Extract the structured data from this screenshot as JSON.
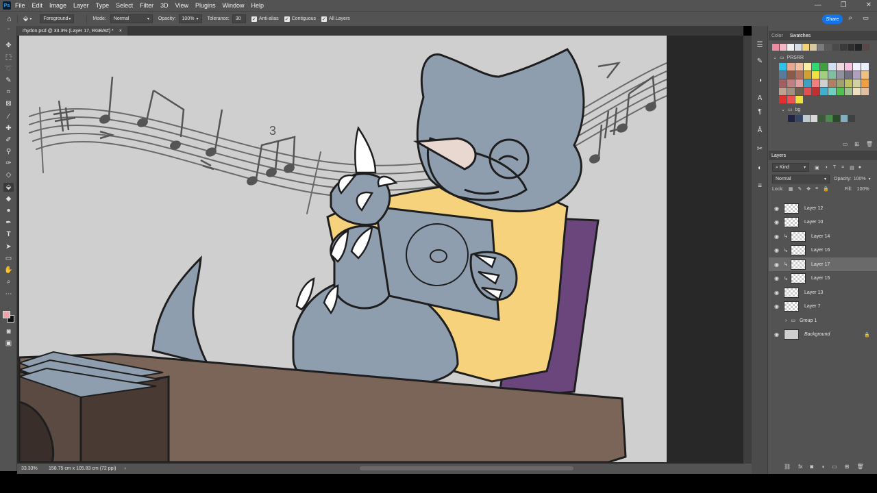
{
  "menu": {
    "logo": "Ps",
    "items": [
      "File",
      "Edit",
      "Image",
      "Layer",
      "Type",
      "Select",
      "Filter",
      "3D",
      "View",
      "Plugins",
      "Window",
      "Help"
    ]
  },
  "options": {
    "fill_source": "Foreground",
    "mode_label": "Mode:",
    "mode_value": "Normal",
    "opacity_label": "Opacity:",
    "opacity_value": "100%",
    "tolerance_label": "Tolerance:",
    "tolerance_value": "30",
    "antialias": "Anti-alias",
    "contiguous": "Contiguous",
    "all_layers": "All Layers",
    "share": "Share"
  },
  "document": {
    "tab_title": "rhydon.psd @ 33.3% (Layer 17, RGB/8#) *",
    "zoom": "33.33%",
    "dimensions": "158.75 cm x 105.83 cm (72 ppi)"
  },
  "swatches_panel": {
    "tabs": [
      "Color",
      "Swatches"
    ],
    "top_colors": [
      "#f08aa0",
      "#f4b8c4",
      "#f0f0f0",
      "#d6dde8",
      "#f2d27a",
      "#d8c8a0",
      "#7a7a7a",
      "#5a5a5a",
      "#4a4a4a",
      "#3a3a3a",
      "#2e2e2e",
      "#222222",
      "#584848"
    ],
    "folder_name": "PRSRR",
    "grid": [
      [
        "#30c0e8",
        "#e8a890",
        "#f0c0a0",
        "#f8f0a0",
        "#30d870",
        "#40a040",
        "#d0e0f0",
        "#f0d8e0",
        "#f8c0e0",
        "#f0f0ff",
        "#e8f0ff"
      ],
      [
        "#5a7a9a",
        "#8a5a4a",
        "#b07060",
        "#d0a030",
        "#f0e040",
        "#a0d080",
        "#80c0a0",
        "#9090a0",
        "#707080",
        "#b0a0c0",
        "#f0c080"
      ],
      [
        "#a06060",
        "#c08080",
        "#e0a0a0",
        "#40a0c0",
        "#f08080",
        "#d0d0d0",
        "#b08060",
        "#a0a070",
        "#c0c060",
        "#d0d0a0",
        "#f0a040"
      ],
      [
        "#c0a090",
        "#a09080",
        "#706050",
        "#e05050",
        "#c03030",
        "#40b0d0",
        "#70d0c0",
        "#50c050",
        "#a0c090",
        "#f0e0c0",
        "#e0c0a0"
      ],
      [
        "#e03030",
        "#f05050",
        "#f0e040"
      ]
    ],
    "subfolder_name": "bg",
    "bg_colors": [
      "#222244",
      "#334466",
      "#c0c8d0",
      "#d8d8d8",
      "#3a5a3a",
      "#4a8a4a",
      "#2a4a2a",
      "#80b0c0",
      "#404040"
    ]
  },
  "layers_panel": {
    "title": "Layers",
    "filter_kind": "Kind",
    "blend_mode": "Normal",
    "opacity_label": "Opacity:",
    "opacity_value": "100%",
    "lock_label": "Lock:",
    "fill_label": "Fill:",
    "fill_value": "100%",
    "layers": [
      {
        "name": "Layer 12",
        "clipped": false,
        "selected": false,
        "visible": true
      },
      {
        "name": "Layer 10",
        "clipped": false,
        "selected": false,
        "visible": true
      },
      {
        "name": "Layer 14",
        "clipped": true,
        "selected": false,
        "visible": true
      },
      {
        "name": "Layer 16",
        "clipped": true,
        "selected": false,
        "visible": true
      },
      {
        "name": "Layer 17",
        "clipped": true,
        "selected": true,
        "visible": true
      },
      {
        "name": "Layer 15",
        "clipped": true,
        "selected": false,
        "visible": true
      },
      {
        "name": "Layer 13",
        "clipped": false,
        "selected": false,
        "visible": true
      },
      {
        "name": "Layer 7",
        "clipped": false,
        "selected": false,
        "visible": true
      },
      {
        "name": "Group 1",
        "clipped": false,
        "selected": false,
        "visible": false
      },
      {
        "name": "Background",
        "clipped": false,
        "selected": false,
        "visible": true
      }
    ]
  },
  "art": {
    "music_note_label": "3",
    "colors": {
      "bg": "#cfcfcf",
      "rhydon": "#8e9eaf",
      "hoodie": "#f7d27d",
      "desk": "#7b6559",
      "chair": "#6a467d",
      "line": "#1e1e1e",
      "claw": "#ffffff",
      "horn": "#e8d8d0"
    }
  }
}
